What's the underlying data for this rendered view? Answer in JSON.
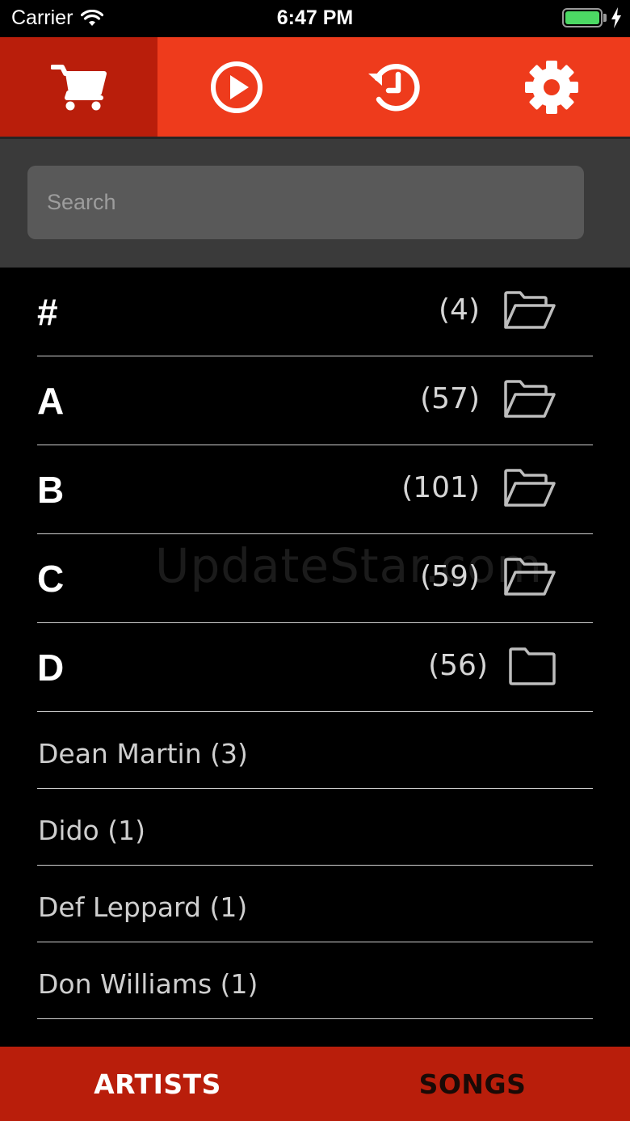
{
  "status_bar": {
    "carrier": "Carrier",
    "time": "6:47 PM",
    "battery_color": "#4cd964"
  },
  "toolbar": {
    "accent": "#ee3b1c",
    "active_color": "#b91e0b",
    "items": [
      {
        "icon": "cart-icon",
        "active": true
      },
      {
        "icon": "play-circle-icon",
        "active": false
      },
      {
        "icon": "history-icon",
        "active": false
      },
      {
        "icon": "gear-icon",
        "active": false
      }
    ]
  },
  "search": {
    "placeholder": "Search",
    "value": ""
  },
  "list": {
    "sections": [
      {
        "letter": "#",
        "count": "(4)",
        "icon": "folder-open-icon"
      },
      {
        "letter": "A",
        "count": "(57)",
        "icon": "folder-open-icon"
      },
      {
        "letter": "B",
        "count": "(101)",
        "icon": "folder-open-icon"
      },
      {
        "letter": "C",
        "count": "(59)",
        "icon": "folder-open-icon"
      },
      {
        "letter": "D",
        "count": "(56)",
        "icon": "folder-closed-icon"
      }
    ],
    "artists": [
      {
        "label": "Dean Martin (3)"
      },
      {
        "label": "Dido (1)"
      },
      {
        "label": "Def Leppard (1)"
      },
      {
        "label": "Don Williams (1)"
      }
    ],
    "watermark": "UpdateStar.com"
  },
  "bottom_tabs": [
    {
      "label": "ARTISTS",
      "active": true
    },
    {
      "label": "SONGS",
      "active": false
    }
  ]
}
